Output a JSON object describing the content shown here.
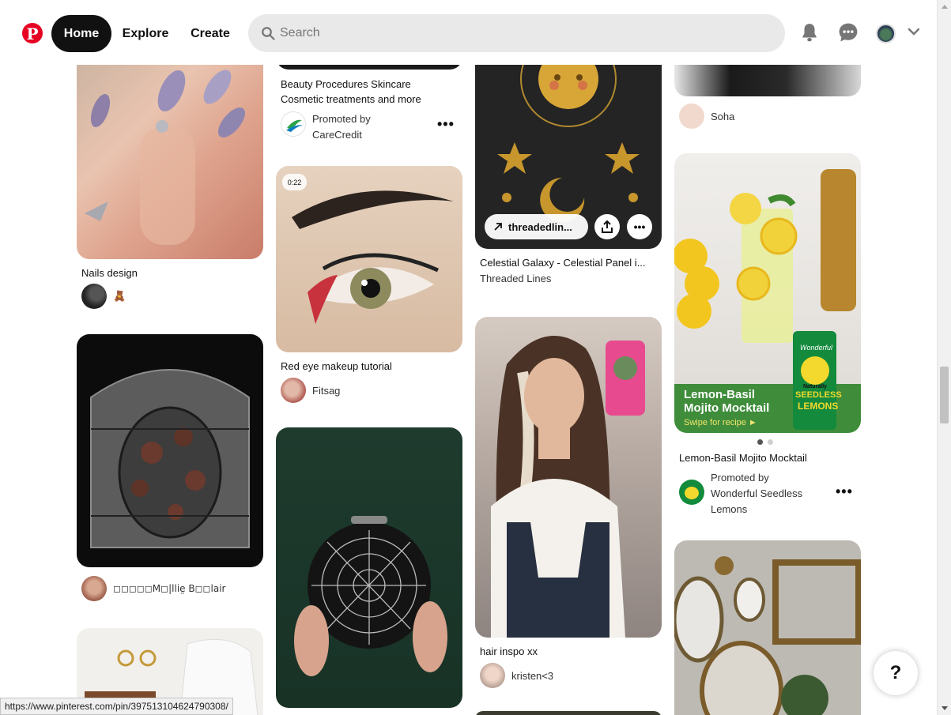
{
  "header": {
    "logo": "P",
    "nav": {
      "home": "Home",
      "explore": "Explore",
      "create": "Create"
    },
    "search_placeholder": "Search",
    "icons": [
      "bell-icon",
      "chat-icon",
      "avatar",
      "chevron-down-icon"
    ]
  },
  "pins": {
    "nails": {
      "title": "Nails design",
      "emoji": "🧸"
    },
    "beauty": {
      "title_line1": "Beauty Procedures Skincare",
      "title_line2": "Cosmetic treatments and more",
      "promoted": "Promoted by",
      "advertiser": "CareCredit",
      "more": "•••"
    },
    "stained": {
      "user": "◻◻◻◻◻M◻|llie̤ B◻◻lair"
    },
    "red_eye": {
      "duration": "0:22",
      "title": "Red eye makeup tutorial",
      "user": "Fitsag"
    },
    "celestial": {
      "link_label": "threadedlin...",
      "title": "Celestial Galaxy - Celestial Panel i...",
      "user": "Threaded Lines",
      "more": "•••"
    },
    "hair": {
      "title": "hair inspo xx",
      "user": "kristen<3"
    },
    "soha": {
      "user": "Soha"
    },
    "mojito": {
      "ad_title_line1": "Lemon-Basil",
      "ad_title_line2": "Mojito Mocktail",
      "ad_cta": "Swipe for recipe ►",
      "pkg_brand": "Wonderful",
      "pkg_line1": "Naturally",
      "pkg_line2": "SEEDLESS",
      "pkg_line3": "LEMONS",
      "title": "Lemon-Basil Mojito Mocktail",
      "promoted": "Promoted by",
      "advertiser_line1": "Wonderful Seedless",
      "advertiser_line2": "Lemons",
      "more": "•••"
    }
  },
  "help_label": "?",
  "status_url": "https://www.pinterest.com/pin/397513104624790308/",
  "colors": {
    "brand": "#e60023",
    "nav_active_bg": "#111111",
    "search_bg": "#e9e9e9"
  }
}
